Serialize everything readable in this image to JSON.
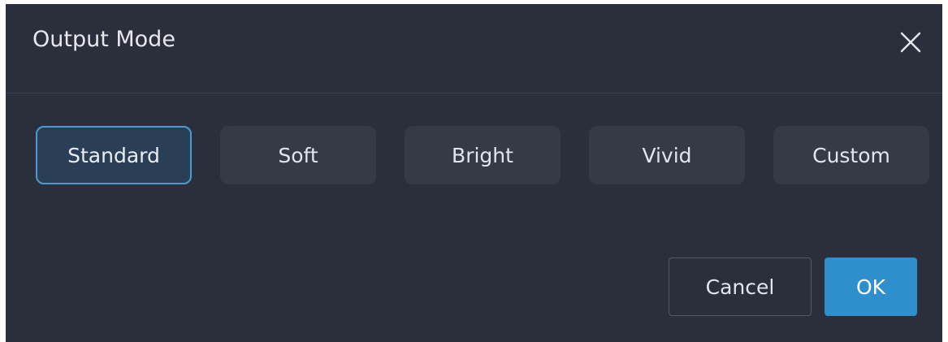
{
  "dialog": {
    "title": "Output Mode",
    "close_icon": "close-icon"
  },
  "modes": {
    "selected": "Standard",
    "items": [
      {
        "label": "Standard"
      },
      {
        "label": "Soft"
      },
      {
        "label": "Bright"
      },
      {
        "label": "Vivid"
      },
      {
        "label": "Custom"
      }
    ]
  },
  "footer": {
    "cancel_label": "Cancel",
    "ok_label": "OK"
  },
  "colors": {
    "dialog_background": "#2b2f3b",
    "mode_button": "#363a47",
    "selected_border": "#4a9bd4",
    "ok_button": "#2e8fcc"
  }
}
